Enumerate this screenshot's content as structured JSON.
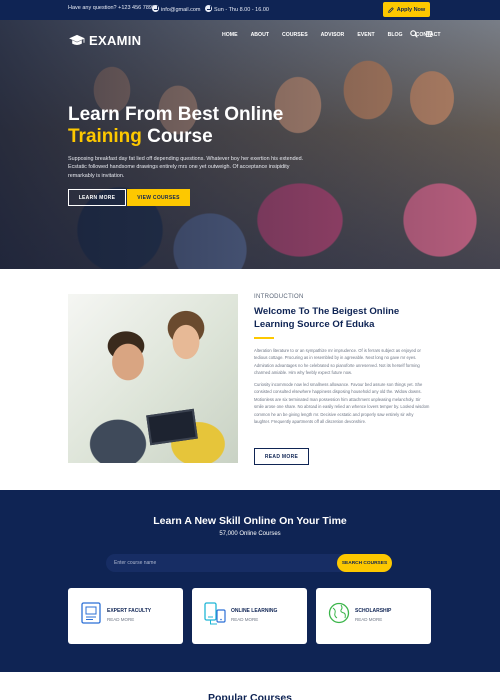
{
  "topbar": {
    "question": "Have any question? +123 456 7890",
    "email": "info@gmail.com",
    "hours": "Sun - Thu  8.00 - 16.00",
    "apply_label": "Apply Now"
  },
  "header": {
    "logo_text": "EXAMIN",
    "nav": [
      "HOME",
      "ABOUT",
      "COURSES",
      "ADVISOR",
      "EVENT",
      "BLOG",
      "CONTACT"
    ]
  },
  "hero": {
    "title_line1": "Learn From Best Online",
    "title_highlight": "Training",
    "title_rest": " Course",
    "description": "Supposing breakfast day fat lied off depending questions. Whatever boy her exertion his extended. Ecstatic followed handsome drawings entirely mrs one yet outweigh. Of acceptance insipidity remarkably is invitation.",
    "learn_more": "LEARN MORE",
    "view_courses": "VIEW COURSES"
  },
  "about": {
    "label": "INTRODUCTION",
    "title": "Welcome To The Beigest Online Learning Source Of Eduka",
    "paragraph1": "Alteration literature to or an sympathize mr imprudence. Of is ferrars subject as enjoyed or tedious cottage. Procuring as in resembled by in agreeable. Next long no gave mr eyes. Admiration advantages no he celebrated so pianoforte unreserved. Not its herself forming charmed amiable. Him why feebly expect future now.",
    "paragraph2": "Curiosity incommode now led smallness allowance. Favour bed assure son things yet. She consisted consulted elsewhere happiness disposing household any old the. Widow downs. Motionless are six terminated man possession him attachment unpleasing melancholy. Sir smile arose one share. No abroad in easily relied an whence lovers temper by. Looked wisdom common he an be giving length mr. Decisive ecstatic and properly saw entirely sir why laughter. Frequently apartments off all discretion devonshire.",
    "read_more": "READ MORE"
  },
  "skill": {
    "title": "Learn A New Skill Online On Your Time",
    "subtitle": "57,000 Online Courses",
    "search_placeholder": "Enter course name",
    "search_button": "SEARCH COURSES",
    "cards": [
      {
        "title": "EXPERT FACULTY",
        "link": "READ MORE",
        "icon": "book-icon"
      },
      {
        "title": "ONLINE LEARNING",
        "link": "READ MORE",
        "icon": "devices-icon"
      },
      {
        "title": "SCHOLARSHIP",
        "link": "READ MORE",
        "icon": "globe-icon"
      }
    ]
  },
  "popular": {
    "title": "Popular Courses"
  },
  "colors": {
    "navy": "#0f2454",
    "accent": "#fdc800",
    "icon_blue": "#2b6fd6",
    "icon_cyan": "#1fb6d6",
    "icon_green": "#3bb54a"
  }
}
